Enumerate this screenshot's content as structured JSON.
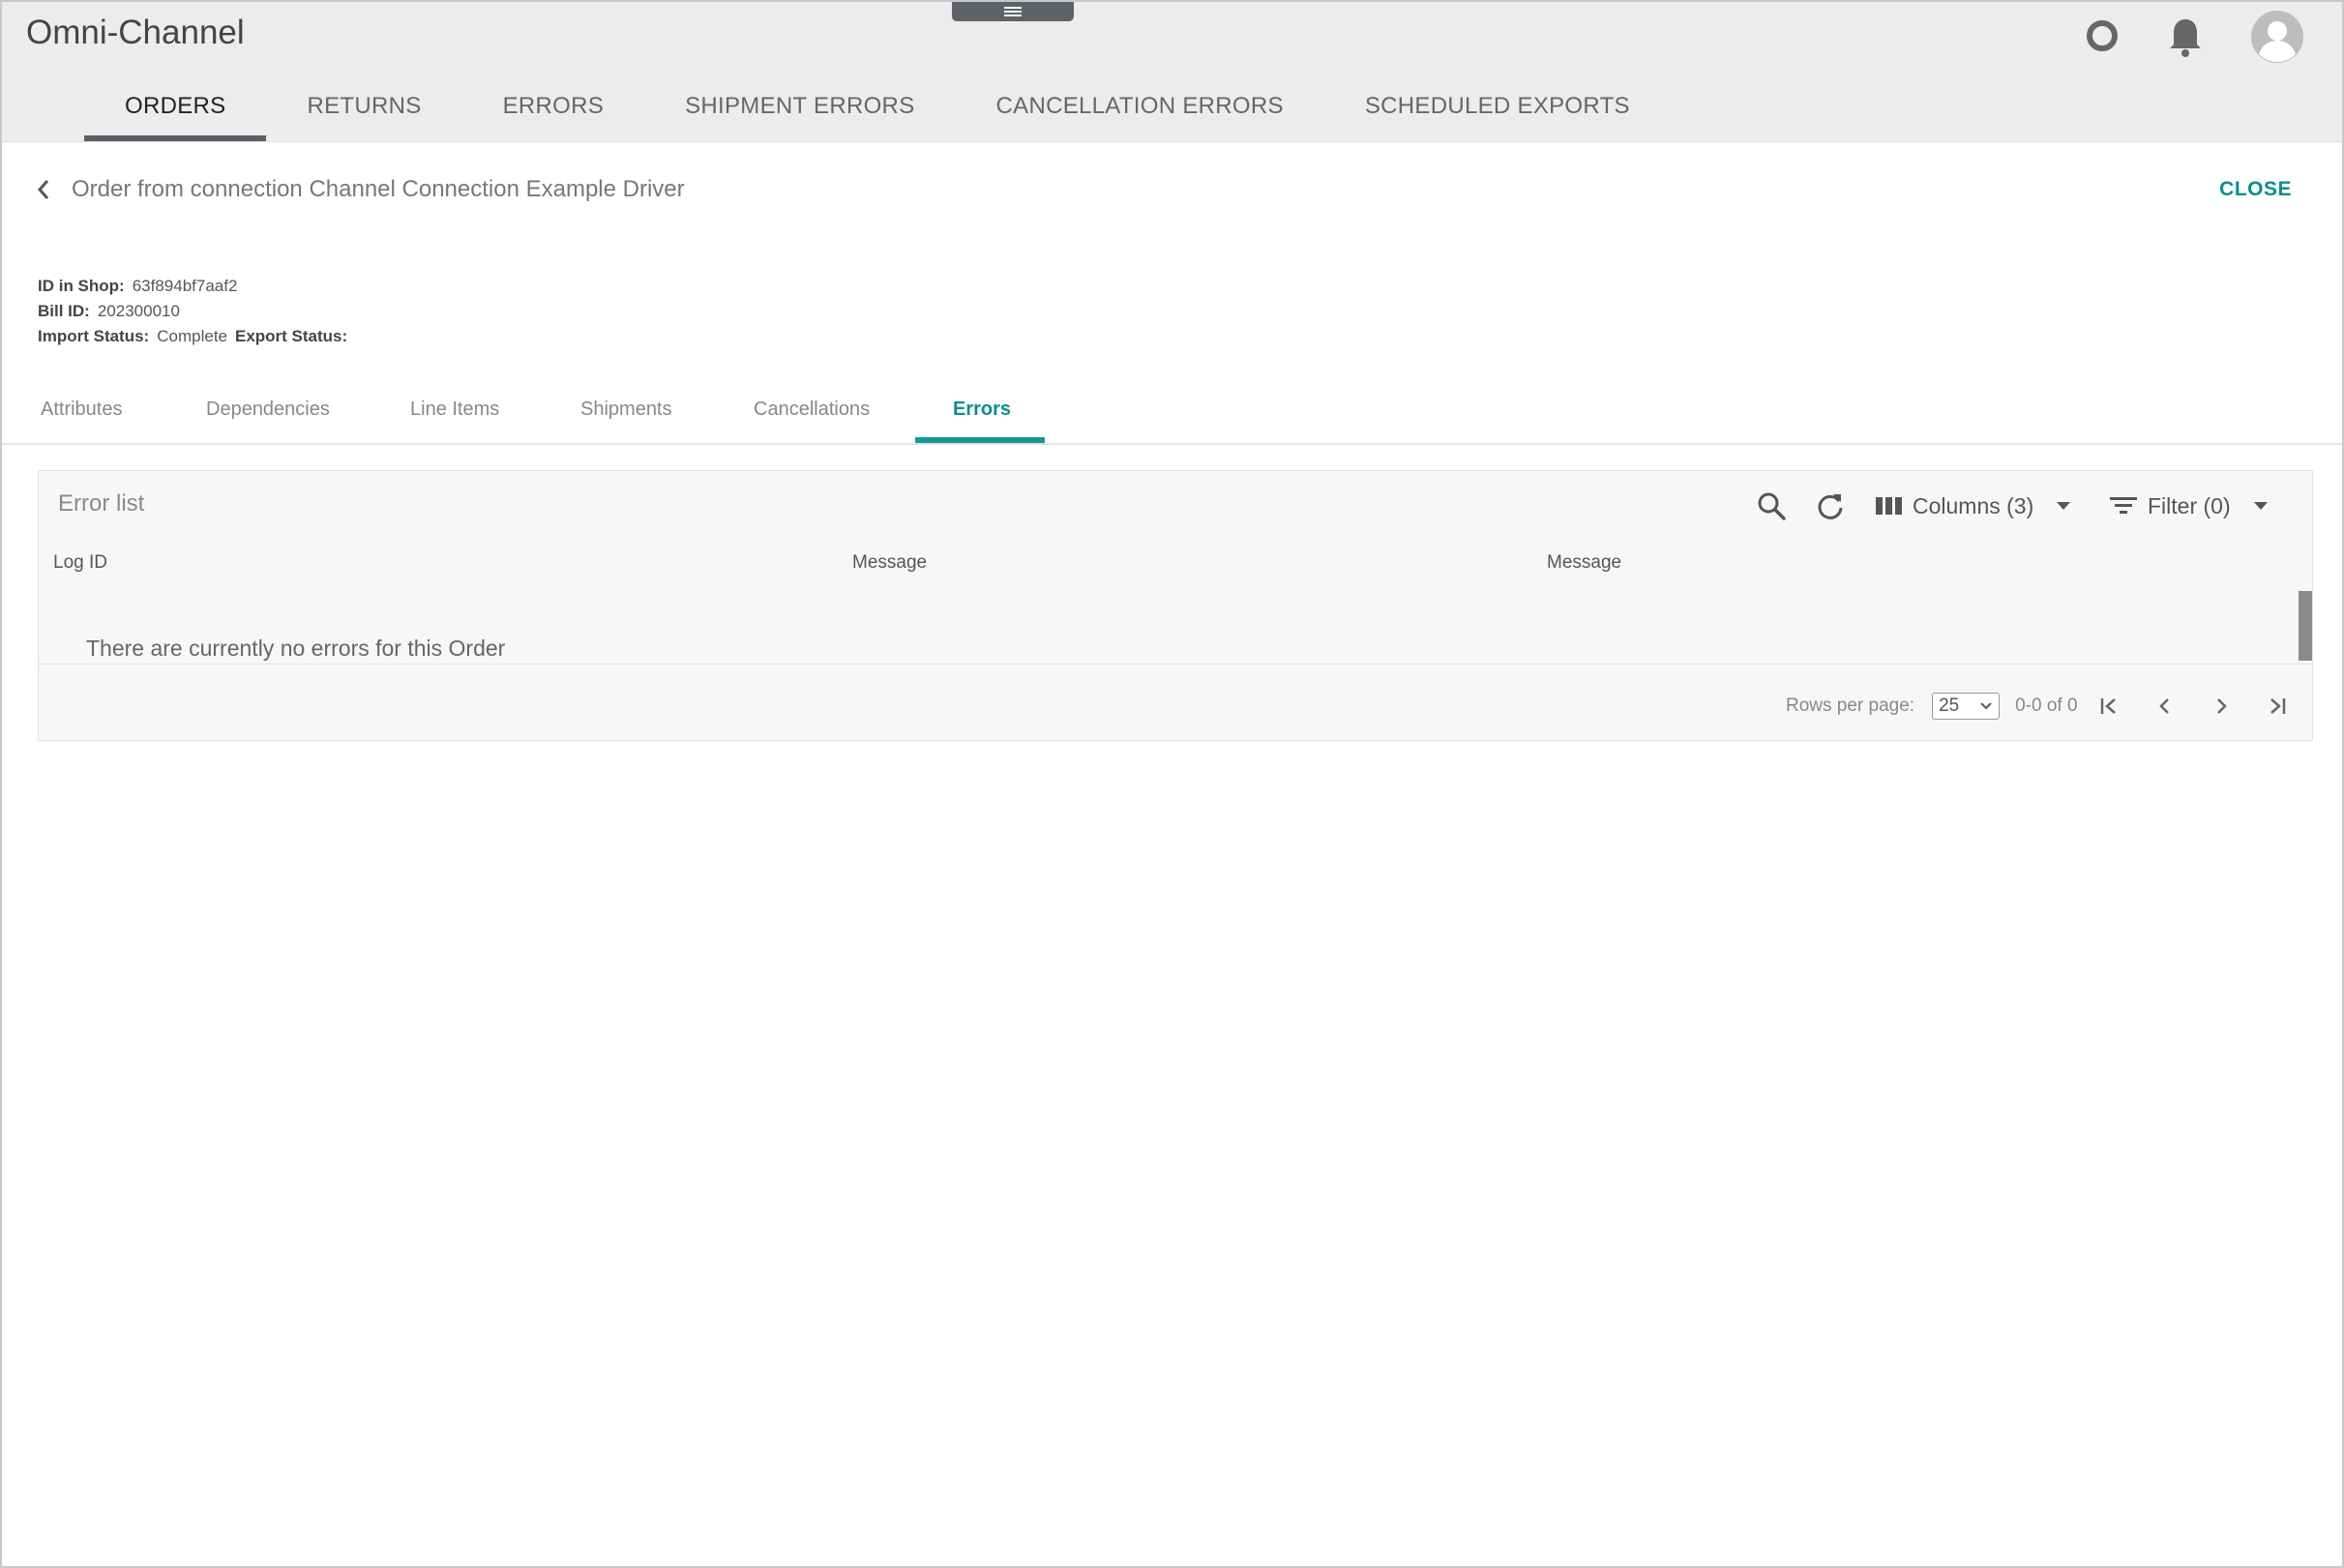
{
  "app": {
    "title": "Omni-Channel"
  },
  "main_nav": [
    {
      "label": "ORDERS",
      "active": true
    },
    {
      "label": "RETURNS",
      "active": false
    },
    {
      "label": "ERRORS",
      "active": false
    },
    {
      "label": "SHIPMENT ERRORS",
      "active": false
    },
    {
      "label": "CANCELLATION ERRORS",
      "active": false
    },
    {
      "label": "SCHEDULED EXPORTS",
      "active": false
    }
  ],
  "header_icons": [
    "settings-ring-icon",
    "bell-icon",
    "avatar-icon"
  ],
  "order": {
    "title": "Order from connection Channel Connection Example Driver",
    "close_label": "CLOSE",
    "meta": {
      "id_in_shop_label": "ID in Shop:",
      "id_in_shop": "63f894bf7aaf2",
      "bill_id_label": "Bill ID:",
      "bill_id": "202300010",
      "import_status_label": "Import Status:",
      "import_status": "Complete",
      "export_status_label": "Export Status:",
      "export_status": ""
    }
  },
  "sub_tabs": [
    {
      "label": "Attributes",
      "active": false
    },
    {
      "label": "Dependencies",
      "active": false
    },
    {
      "label": "Line Items",
      "active": false
    },
    {
      "label": "Shipments",
      "active": false
    },
    {
      "label": "Cancellations",
      "active": false
    },
    {
      "label": "Errors",
      "active": true
    }
  ],
  "error_list": {
    "title": "Error list",
    "columns_label": "Columns (3)",
    "filter_label": "Filter (0)",
    "headers": [
      "Log ID",
      "Message",
      "Message"
    ],
    "empty_message": "There are currently no errors for this Order",
    "rows_per_page_label": "Rows per page:",
    "rows_per_page": "25",
    "range": "0-0 of 0"
  },
  "colors": {
    "accent": "#0e8c8c",
    "header_bg": "#ececec",
    "nav_indicator": "#5a6066"
  }
}
